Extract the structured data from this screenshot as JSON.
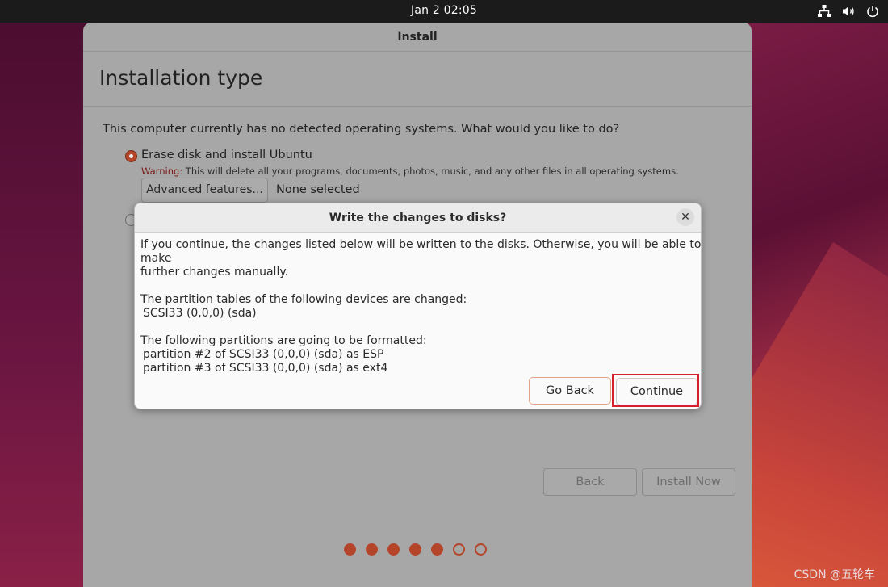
{
  "topbar": {
    "clock": "Jan 2  02:05",
    "icons": [
      "network-icon",
      "volume-icon",
      "power-icon"
    ]
  },
  "window": {
    "title": "Install",
    "page_title": "Installation type",
    "question": "This computer currently has no detected operating systems. What would you like to do?",
    "option_erase": {
      "label": "Erase disk and install Ubuntu",
      "selected": true,
      "warning_prefix": "Warning:",
      "warning_text": " This will delete all your programs, documents, photos, music, and any other files in all operating systems."
    },
    "advanced_button": "Advanced features...",
    "advanced_status": "None selected",
    "option_other_selected": false,
    "back_button": "Back",
    "install_now_button": "Install Now",
    "progress": {
      "completed_steps": 5,
      "total_steps": 7
    }
  },
  "dialog": {
    "title": "Write the changes to disks?",
    "close_icon": "close-icon",
    "intro_line1": "If you continue, the changes listed below will be written to the disks. Otherwise, you will be able to make",
    "intro_line2": "further changes manually.",
    "partition_tables_heading": "The partition tables of the following devices are changed:",
    "partition_tables_item": "SCSI33 (0,0,0) (sda)",
    "format_heading": "The following partitions are going to be formatted:",
    "format_items": [
      "partition #2 of SCSI33 (0,0,0) (sda) as ESP",
      "partition #3 of SCSI33 (0,0,0) (sda) as ext4"
    ],
    "go_back_button": "Go Back",
    "continue_button": "Continue"
  },
  "watermark": "CSDN @五轮车",
  "colors": {
    "accent": "#b5452a",
    "highlight_box": "#d4212b",
    "topbar": "#1b1b1b"
  }
}
